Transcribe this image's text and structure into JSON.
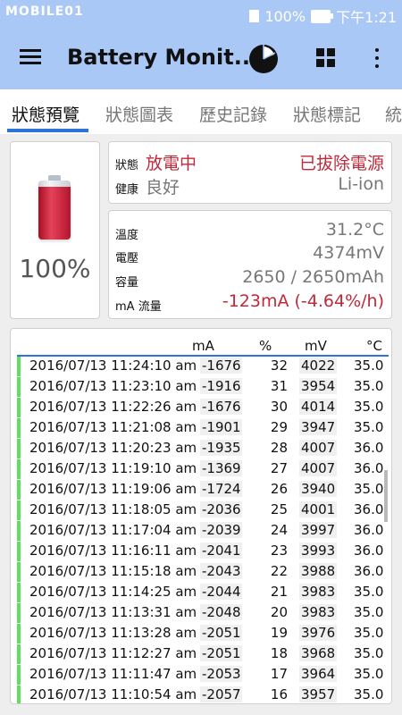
{
  "statusbar": {
    "logo": "MOBILE01",
    "battery": "100%",
    "time": "下午1:21"
  },
  "appbar": {
    "title": "Battery Monit..."
  },
  "tabs": [
    {
      "label": "狀態預覽"
    },
    {
      "label": "狀態圖表"
    },
    {
      "label": "歷史記錄"
    },
    {
      "label": "狀態標記"
    },
    {
      "label": "統"
    }
  ],
  "battery": {
    "level": 100,
    "level_label": "100%"
  },
  "status": {
    "state_label": "狀態",
    "state_value": "放電中",
    "plug_value": "已拔除電源",
    "health_label": "健康",
    "health_value": "良好",
    "tech_value": "Li-ion"
  },
  "info": {
    "temp_label": "溫度",
    "temp_value": "31.2°C",
    "voltage_label": "電壓",
    "voltage_value": "4374mV",
    "capacity_label": "容量",
    "capacity_value": "2650 / 2650mAh",
    "current_label": "mA 流量",
    "current_value": "-123mA (-4.64%/h)"
  },
  "log": {
    "headers": {
      "ma": "mA",
      "pct": "%",
      "mv": "mV",
      "temp": "°C"
    },
    "rows": [
      {
        "date": "2016/07/13  11:24:10 am",
        "ma": "-1676",
        "pct": "32",
        "mv": "4022",
        "temp": "35.0"
      },
      {
        "date": "2016/07/13  11:23:10 am",
        "ma": "-1916",
        "pct": "31",
        "mv": "3954",
        "temp": "35.0"
      },
      {
        "date": "2016/07/13  11:22:26 am",
        "ma": "-1676",
        "pct": "30",
        "mv": "4014",
        "temp": "35.0"
      },
      {
        "date": "2016/07/13  11:21:08 am",
        "ma": "-1901",
        "pct": "29",
        "mv": "3947",
        "temp": "35.0"
      },
      {
        "date": "2016/07/13  11:20:23 am",
        "ma": "-1935",
        "pct": "28",
        "mv": "4007",
        "temp": "36.0"
      },
      {
        "date": "2016/07/13  11:19:10 am",
        "ma": "-1369",
        "pct": "27",
        "mv": "4007",
        "temp": "36.0"
      },
      {
        "date": "2016/07/13  11:19:06 am",
        "ma": "-1724",
        "pct": "26",
        "mv": "3940",
        "temp": "35.0"
      },
      {
        "date": "2016/07/13  11:18:05 am",
        "ma": "-2036",
        "pct": "25",
        "mv": "4001",
        "temp": "36.0"
      },
      {
        "date": "2016/07/13  11:17:04 am",
        "ma": "-2039",
        "pct": "24",
        "mv": "3997",
        "temp": "36.0"
      },
      {
        "date": "2016/07/13  11:16:11 am",
        "ma": "-2041",
        "pct": "23",
        "mv": "3993",
        "temp": "36.0"
      },
      {
        "date": "2016/07/13  11:15:18 am",
        "ma": "-2043",
        "pct": "22",
        "mv": "3988",
        "temp": "36.0"
      },
      {
        "date": "2016/07/13  11:14:25 am",
        "ma": "-2044",
        "pct": "21",
        "mv": "3983",
        "temp": "35.0"
      },
      {
        "date": "2016/07/13  11:13:31 am",
        "ma": "-2048",
        "pct": "20",
        "mv": "3983",
        "temp": "35.0"
      },
      {
        "date": "2016/07/13  11:13:28 am",
        "ma": "-2051",
        "pct": "19",
        "mv": "3976",
        "temp": "35.0"
      },
      {
        "date": "2016/07/13  11:12:27 am",
        "ma": "-2051",
        "pct": "18",
        "mv": "3968",
        "temp": "35.0"
      },
      {
        "date": "2016/07/13  11:11:47 am",
        "ma": "-2053",
        "pct": "17",
        "mv": "3964",
        "temp": "35.0"
      },
      {
        "date": "2016/07/13  11:10:54 am",
        "ma": "-2057",
        "pct": "16",
        "mv": "3957",
        "temp": "35.0"
      }
    ]
  }
}
